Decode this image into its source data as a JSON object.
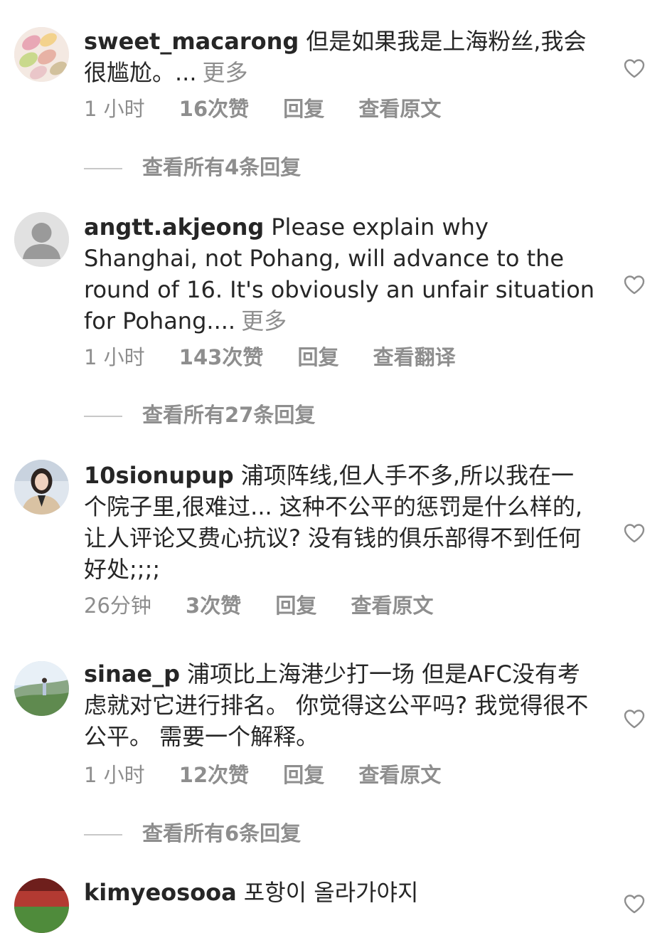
{
  "comments": [
    {
      "username": "sweet_macarong",
      "text": "但是如果我是上海粉丝,我会很尴尬。...",
      "more": "更多",
      "time": "1 小时",
      "likes": "16次赞",
      "reply": "回复",
      "translate": "查看原文",
      "view_replies": "查看所有4条回复",
      "avatar_icon": "macaron-photo-avatar"
    },
    {
      "username": "angtt.akjeong",
      "text": "Please explain why Shanghai, not Pohang, will advance to the round of 16. It's obviously an unfair situation for Pohang....",
      "more": "更多",
      "time": "1 小时",
      "likes": "143次赞",
      "reply": "回复",
      "translate": "查看翻译",
      "view_replies": "查看所有27条回复",
      "avatar_icon": "default-person-avatar"
    },
    {
      "username": "10sionupup",
      "text": "浦项阵线,但人手不多,所以我在一个院子里,很难过... 这种不公平的惩罚是什么样的,让人评论又费心抗议? 没有钱的俱乐部得不到任何好处;;;;",
      "time": "26分钟",
      "likes": "3次赞",
      "reply": "回复",
      "translate": "查看原文",
      "avatar_icon": "woman-portrait-avatar"
    },
    {
      "username": "sinae_p",
      "text": "浦项比上海港少打一场 但是AFC没有考虑就对它进行排名。 你觉得这公平吗? 我觉得很不公平。 需要一个解释。",
      "time": "1 小时",
      "likes": "12次赞",
      "reply": "回复",
      "translate": "查看原文",
      "view_replies": "查看所有6条回复",
      "avatar_icon": "landscape-photo-avatar"
    },
    {
      "username": "kimyeosooa",
      "text": "포항이 올라가야지",
      "avatar_icon": "stadium-photo-avatar"
    }
  ],
  "colors": {
    "text": "#262626",
    "secondary": "#8e8e8e",
    "divider": "#c8c8c8"
  }
}
